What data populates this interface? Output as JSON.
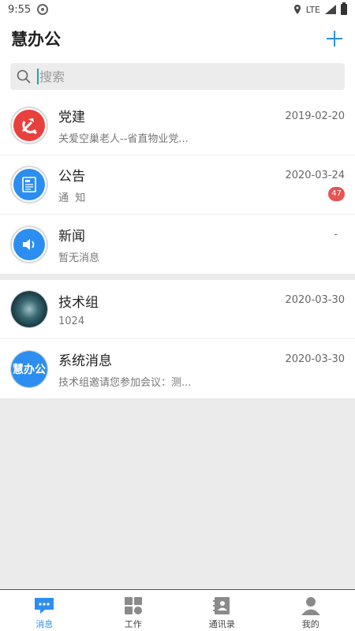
{
  "status_bar": {
    "time": "9:55",
    "network": "LTE"
  },
  "header": {
    "title": "慧办公",
    "add_icon": "plus-icon"
  },
  "search": {
    "placeholder": "搜索"
  },
  "conversations": [
    {
      "name": "党建",
      "preview": "关爱空巢老人--省直物业党...",
      "date": "2019-02-20",
      "avatar": "party-emblem-icon",
      "color": "#e8413d"
    },
    {
      "name": "公告",
      "preview": "通  知",
      "date": "2020-03-24",
      "badge": "47",
      "avatar": "newspaper-icon",
      "color": "#2c8ef0"
    },
    {
      "name": "新闻",
      "preview": "暂无消息",
      "date": "-",
      "avatar": "speaker-icon",
      "color": "#2c8ef0"
    }
  ],
  "groups": [
    {
      "name": "技术组",
      "preview": "1024",
      "date": "2020-03-30",
      "avatar": "group-photo"
    },
    {
      "name": "系统消息",
      "preview": "技术组邀请您参加会议：测...",
      "date": "2020-03-30",
      "avatar": "app-logo",
      "logo_text": "慧办公"
    }
  ],
  "tabs": [
    {
      "label": "消息",
      "icon": "chat-icon",
      "active": true
    },
    {
      "label": "工作",
      "icon": "grid-icon",
      "active": false
    },
    {
      "label": "通讯录",
      "icon": "contacts-icon",
      "active": false
    },
    {
      "label": "我的",
      "icon": "person-icon",
      "active": false
    }
  ],
  "colors": {
    "accent": "#2c8ef0",
    "badge": "#e55353"
  }
}
